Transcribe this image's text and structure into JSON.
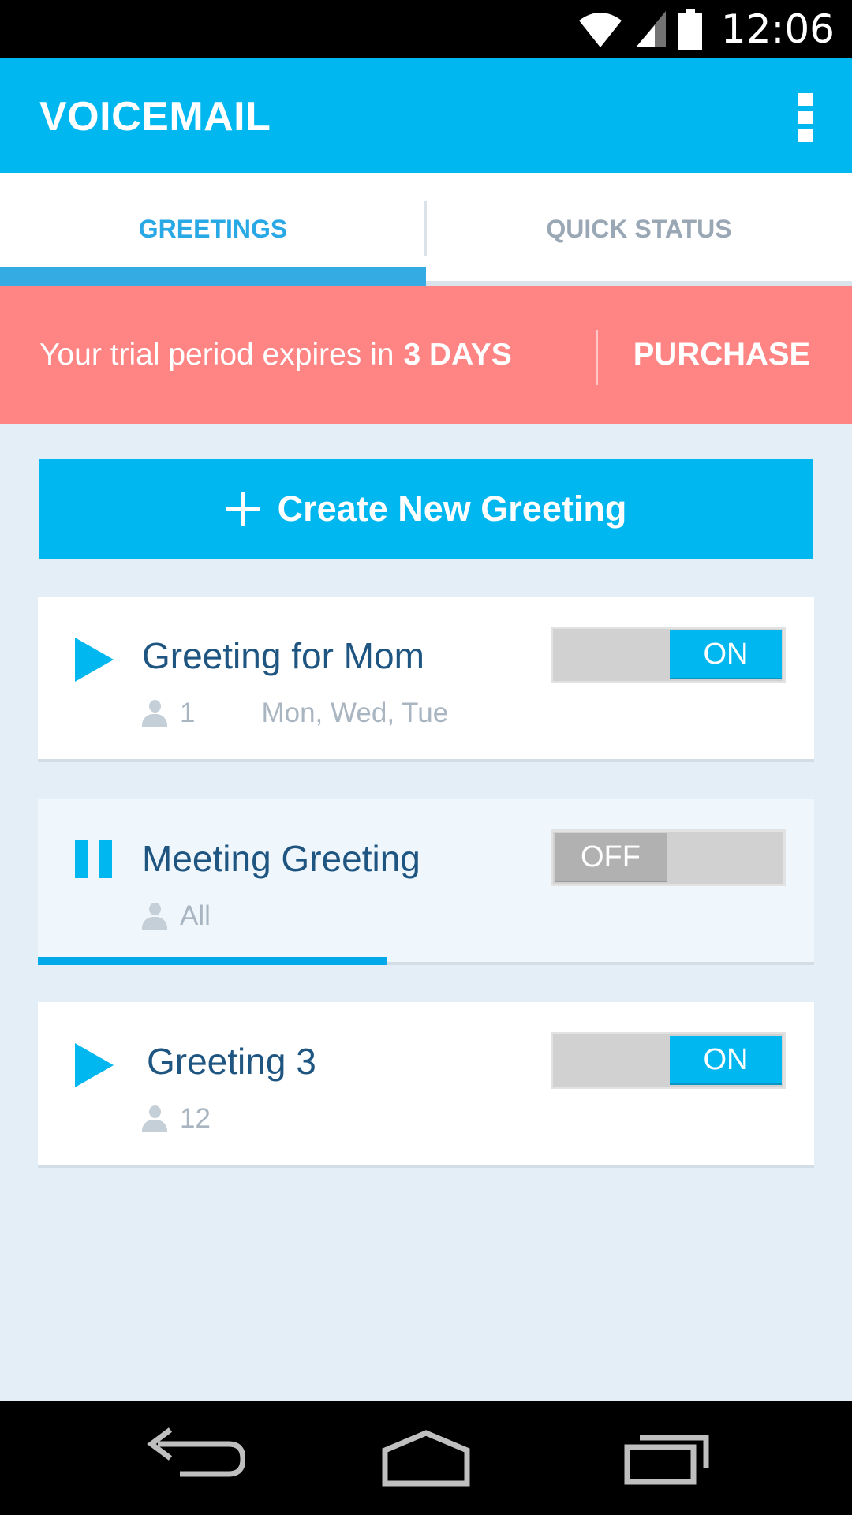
{
  "status_bar": {
    "time": "12:06",
    "icons": [
      "wifi-icon",
      "signal-icon",
      "battery-icon"
    ]
  },
  "app_bar": {
    "title": "VOICEMAIL",
    "menu_icon": "overflow-menu-icon"
  },
  "tabs": [
    {
      "label": "GREETINGS",
      "selected": true
    },
    {
      "label": "QUICK STATUS",
      "selected": false
    }
  ],
  "trial_banner": {
    "text": "Your trial period expires in",
    "highlight": "3 DAYS",
    "action_label": "PURCHASE"
  },
  "create_button": {
    "label": "Create New Greeting",
    "icon": "plus-icon"
  },
  "greetings": [
    {
      "name": "Greeting for Mom",
      "recipients": "1",
      "schedule": "Mon, Wed, Tue",
      "toggle_label": "ON",
      "enabled": true,
      "playing": false
    },
    {
      "name": "Meeting Greeting",
      "recipients": "All",
      "schedule": "",
      "toggle_label": "OFF",
      "enabled": false,
      "playing": true,
      "playback_progress": 0.45
    },
    {
      "name": "Greeting 3",
      "recipients": "12",
      "schedule": "",
      "toggle_label": "ON",
      "enabled": true,
      "playing": false
    }
  ],
  "nav_bar": {
    "icons": [
      "back-icon",
      "home-icon",
      "recents-icon"
    ]
  },
  "colors": {
    "accent": "#00b7f0",
    "banner": "#ff8585",
    "background": "#e4eef7",
    "title_text": "#1f5581"
  }
}
